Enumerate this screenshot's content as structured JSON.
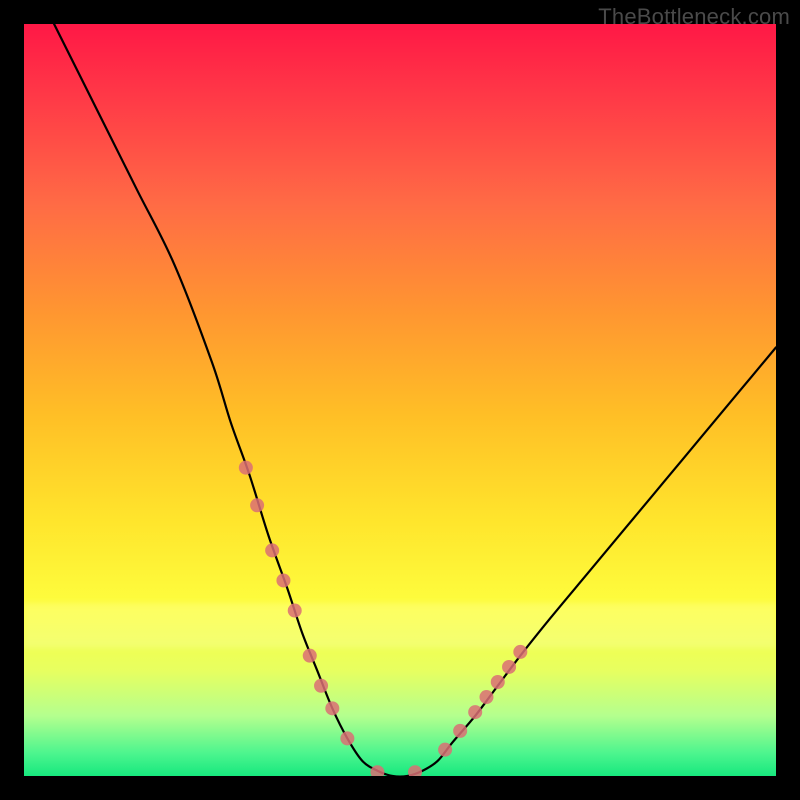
{
  "watermark": "TheBottleneck.com",
  "colors": {
    "frame": "#000000",
    "curve": "#000000",
    "marker": "#da6e74",
    "gradient_top": "#ff1846",
    "gradient_bottom": "#17e87e"
  },
  "chart_data": {
    "type": "line",
    "title": "",
    "xlabel": "",
    "ylabel": "",
    "xlim": [
      0,
      100
    ],
    "ylim": [
      0,
      100
    ],
    "series": [
      {
        "name": "bottleneck-curve",
        "x": [
          4,
          10,
          15,
          20,
          25,
          27.5,
          30,
          32.5,
          35,
          37,
          39,
          41,
          43,
          45,
          47,
          49,
          51,
          53,
          55,
          57,
          60,
          63,
          66,
          70,
          75,
          80,
          85,
          90,
          95,
          100
        ],
        "y": [
          100,
          88,
          78,
          68,
          55,
          47,
          40,
          32,
          25,
          19,
          14,
          9,
          5,
          2,
          0.7,
          0,
          0,
          0.7,
          2,
          4.5,
          8,
          12,
          16,
          21,
          27,
          33,
          39,
          45,
          51,
          57
        ]
      },
      {
        "name": "marker-dots",
        "x": [
          29.5,
          31,
          33,
          34.5,
          36,
          38,
          39.5,
          41,
          43,
          47,
          52,
          56,
          58,
          60,
          61.5,
          63,
          64.5,
          66
        ],
        "y": [
          41,
          36,
          30,
          26,
          22,
          16,
          12,
          9,
          5,
          0.5,
          0.5,
          3.5,
          6,
          8.5,
          10.5,
          12.5,
          14.5,
          16.5
        ]
      }
    ]
  }
}
